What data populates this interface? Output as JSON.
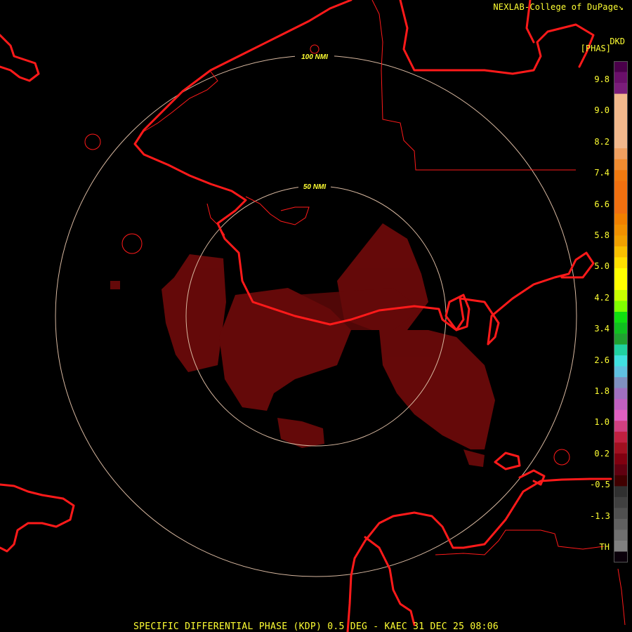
{
  "header": {
    "credit": "NEXLAB-College of DuPage",
    "credit_icon": "cursor-arrow-icon",
    "product_code": "DKD",
    "units": "[PHAS]"
  },
  "footer": {
    "caption": "SPECIFIC DIFFERENTIAL PHASE (KDP) 0.5 DEG - KAEC 31 DEC 25 08:06"
  },
  "range_rings": [
    {
      "label": "100 NMI",
      "range_nmi": 100
    },
    {
      "label": "50 NMI",
      "range_nmi": 50
    }
  ],
  "legend": {
    "labels": [
      "9.8",
      "9.0",
      "8.2",
      "7.4",
      "6.6",
      "5.8",
      "5.0",
      "4.2",
      "3.4",
      "2.6",
      "1.8",
      "1.0",
      "0.2",
      "-0.5",
      "-1.3",
      "TH"
    ],
    "colors": [
      "#4a004a",
      "#6a0f6a",
      "#7a1d7a",
      "#f2b88c",
      "#f2b88c",
      "#f2b88c",
      "#f2b88c",
      "#f2b88c",
      "#f0a060",
      "#f08c30",
      "#f07a10",
      "#f07010",
      "#f07010",
      "#f07010",
      "#f08000",
      "#f09000",
      "#f0a000",
      "#f8c000",
      "#ffe000",
      "#ffff00",
      "#ffff00",
      "#c8ff00",
      "#80ff00",
      "#10e010",
      "#10c020",
      "#20a030",
      "#20d0a0",
      "#40e0e0",
      "#60c0e0",
      "#8090c0",
      "#a070c0",
      "#c060c0",
      "#e060c0",
      "#d04080",
      "#c02040",
      "#a01020",
      "#800010",
      "#600010",
      "#400000",
      "#303030",
      "#404040",
      "#505050",
      "#606060",
      "#707070",
      "#808080",
      "#0a000a"
    ]
  },
  "colors": {
    "map_lines": "#ff1a1a",
    "range_ring": "#d8b8a0",
    "ring_label": "#ffff33",
    "echo": "#6a0a0a"
  }
}
